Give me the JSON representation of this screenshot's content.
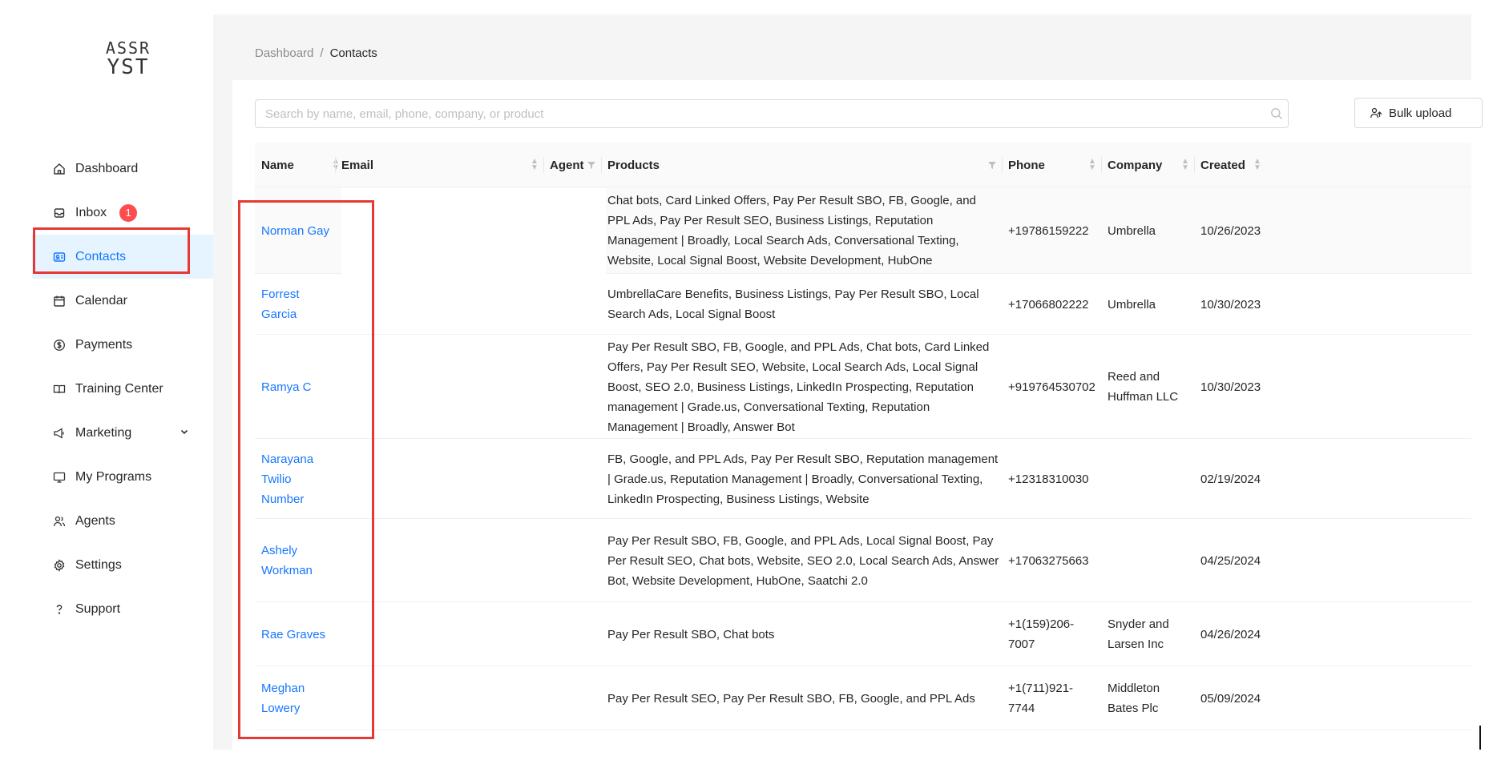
{
  "logo": {
    "line1": "ASSR",
    "line2": "YST",
    "subtitle": ""
  },
  "nav": [
    {
      "label": "Dashboard",
      "icon": "home-icon"
    },
    {
      "label": "Inbox",
      "icon": "inbox-icon",
      "badge": "1"
    },
    {
      "label": "Contacts",
      "icon": "contacts-icon",
      "active": true
    },
    {
      "label": "Calendar",
      "icon": "calendar-icon"
    },
    {
      "label": "Payments",
      "icon": "dollar-icon"
    },
    {
      "label": "Training Center",
      "icon": "book-icon"
    },
    {
      "label": "Marketing",
      "icon": "megaphone-icon",
      "expandable": true
    },
    {
      "label": "My Programs",
      "icon": "monitor-icon"
    },
    {
      "label": "Agents",
      "icon": "agents-icon"
    },
    {
      "label": "Settings",
      "icon": "gear-icon"
    },
    {
      "label": "Support",
      "icon": "question-icon"
    }
  ],
  "breadcrumb": {
    "root": "Dashboard",
    "sep": "/",
    "current": "Contacts"
  },
  "search": {
    "placeholder": "Search by name, email, phone, company, or product",
    "value": ""
  },
  "bulk_upload": {
    "label": "Bulk upload",
    "icon": "upload-user-icon"
  },
  "columns": {
    "name": "Name",
    "email": "Email",
    "agent": "Agent",
    "products": "Products",
    "phone": "Phone",
    "company": "Company",
    "created": "Created"
  },
  "rows": [
    {
      "name": "Norman Gay",
      "email": "",
      "products": "Chat bots, Card Linked Offers, Pay Per Result SBO, FB, Google, and PPL Ads, Pay Per Result SEO, Business Listings, Reputation Management | Broadly, Local Search Ads, Conversational Texting, Website, Local Signal Boost, Website Development, HubOne",
      "phone": "+19786159222",
      "company": "Umbrella",
      "created": "10/26/2023"
    },
    {
      "name": "Forrest Garcia",
      "email": "",
      "products": "UmbrellaCare Benefits, Business Listings, Pay Per Result SBO, Local Search Ads, Local Signal Boost",
      "phone": "+17066802222",
      "company": "Umbrella",
      "created": "10/30/2023"
    },
    {
      "name": "Ramya C",
      "email": "",
      "products": "Pay Per Result SBO, FB, Google, and PPL Ads, Chat bots, Card Linked Offers, Pay Per Result SEO, Website, Local Search Ads, Local Signal Boost, SEO 2.0, Business Listings, LinkedIn Prospecting, Reputation management | Grade.us, Conversational Texting, Reputation Management | Broadly, Answer Bot",
      "phone": "+919764530702",
      "company": "Reed and Huffman LLC",
      "created": "10/30/2023"
    },
    {
      "name": "Narayana Twilio Number",
      "email": "",
      "products": "FB, Google, and PPL Ads, Pay Per Result SBO, Reputation management | Grade.us, Reputation Management | Broadly, Conversational Texting, LinkedIn Prospecting, Business Listings, Website",
      "phone": "+12318310030",
      "company": "",
      "created": "02/19/2024"
    },
    {
      "name": "Ashely Workman",
      "email": "",
      "products": "Pay Per Result SBO, FB, Google, and PPL Ads, Local Signal Boost, Pay Per Result SEO, Chat bots, Website, SEO 2.0, Local Search Ads, Answer Bot, Website Development, HubOne, Saatchi 2.0",
      "phone": "+17063275663",
      "company": "",
      "created": "04/25/2024"
    },
    {
      "name": "Rae Graves",
      "email": "",
      "products": "Pay Per Result SBO, Chat bots",
      "phone": "+1(159)206-7007",
      "company": "Snyder and Larsen Inc",
      "created": "04/26/2024"
    },
    {
      "name": "Meghan Lowery",
      "email": "",
      "products": "Pay Per Result SEO, Pay Per Result SBO, FB, Google, and PPL Ads",
      "phone": "+1(711)921-7744",
      "company": "Middleton Bates Plc",
      "created": "05/09/2024"
    }
  ]
}
